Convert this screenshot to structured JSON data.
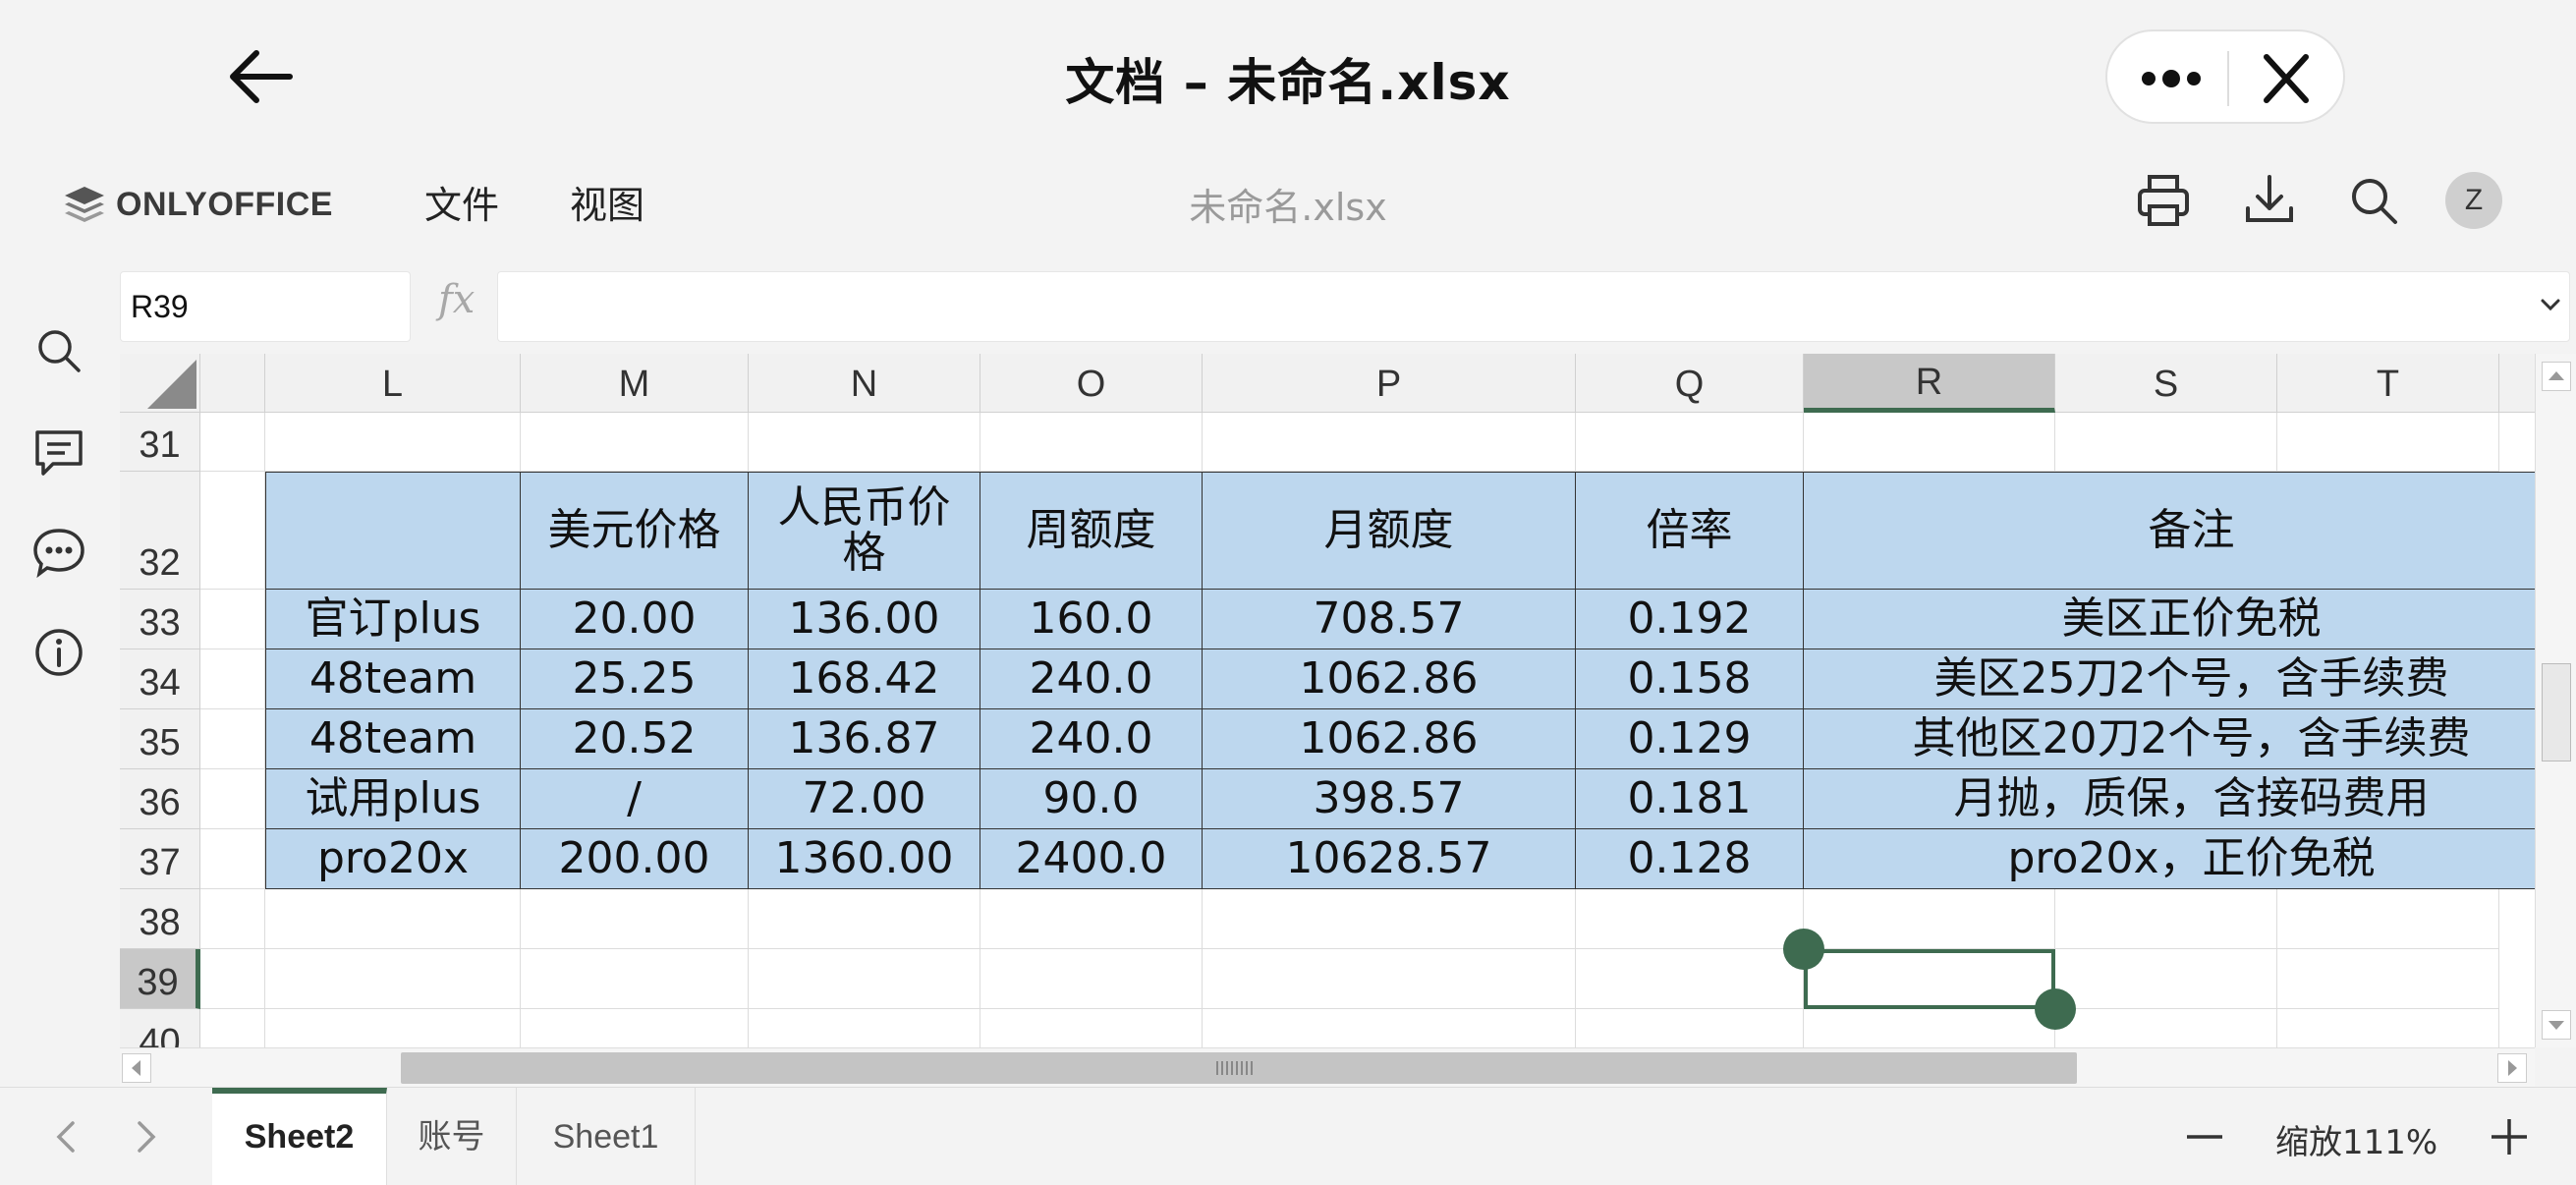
{
  "window": {
    "title": "文档 – 未命名.xlsx"
  },
  "toolbar": {
    "brand": "ONLYOFFICE",
    "menu": [
      "文件",
      "视图"
    ],
    "doc_name": "未命名.xlsx",
    "avatar_initial": "Z",
    "icons": [
      "print-icon",
      "download-icon",
      "search-icon"
    ]
  },
  "sidebar": {
    "icons": [
      "search-icon",
      "comment-icon",
      "chat-icon",
      "info-icon"
    ]
  },
  "formula_bar": {
    "cell_ref": "R39",
    "fx": "fx",
    "value": ""
  },
  "grid": {
    "columns": [
      "L",
      "M",
      "N",
      "O",
      "P",
      "Q",
      "R",
      "S",
      "T"
    ],
    "selected_column": "R",
    "selected_row": "39",
    "rows": [
      "31",
      "32",
      "33",
      "34",
      "35",
      "36",
      "37",
      "38",
      "39",
      "40"
    ],
    "table": {
      "header": [
        "",
        "美元价格",
        "人民币价格",
        "周额度",
        "月额度",
        "倍率",
        "备注"
      ],
      "rows": [
        [
          "官订plus",
          "20.00",
          "136.00",
          "160.0",
          "708.57",
          "0.192",
          "美区正价免税"
        ],
        [
          "48team",
          "25.25",
          "168.42",
          "240.0",
          "1062.86",
          "0.158",
          "美区25刀2个号，含手续费"
        ],
        [
          "48team",
          "20.52",
          "136.87",
          "240.0",
          "1062.86",
          "0.129",
          "其他区20刀2个号，含手续费"
        ],
        [
          "试用plus",
          "/",
          "72.00",
          "90.0",
          "398.57",
          "0.181",
          "月抛，质保，含接码费用"
        ],
        [
          "pro20x",
          "200.00",
          "1360.00",
          "2400.0",
          "10628.57",
          "0.128",
          "pro20x，正价免税"
        ]
      ]
    }
  },
  "sheets": {
    "tabs": [
      "Sheet2",
      "账号",
      "Sheet1"
    ],
    "active": "Sheet2"
  },
  "zoom": {
    "label": "缩放111%"
  },
  "colors": {
    "accent": "#3e6b50",
    "table_fill": "#bdd7ee"
  }
}
